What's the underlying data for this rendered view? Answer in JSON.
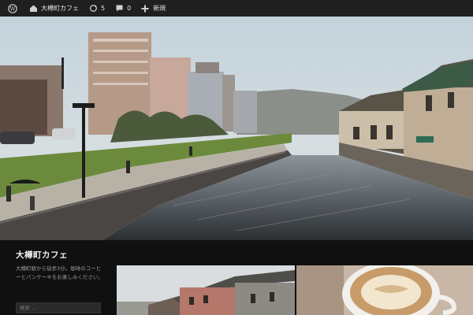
{
  "adminbar": {
    "site_name": "大樽町カフェ",
    "updates_count": "5",
    "comments_count": "0",
    "new_label": "新規"
  },
  "site": {
    "title": "大樽町カフェ",
    "description": "大樽町駅から徒歩3分。珈琲のコーヒーとパンケーキをお楽しみください。",
    "search_label": "検索 …"
  },
  "colors": {
    "adminbar_bg": "#1f1f1f",
    "panel_bg": "#101010"
  }
}
